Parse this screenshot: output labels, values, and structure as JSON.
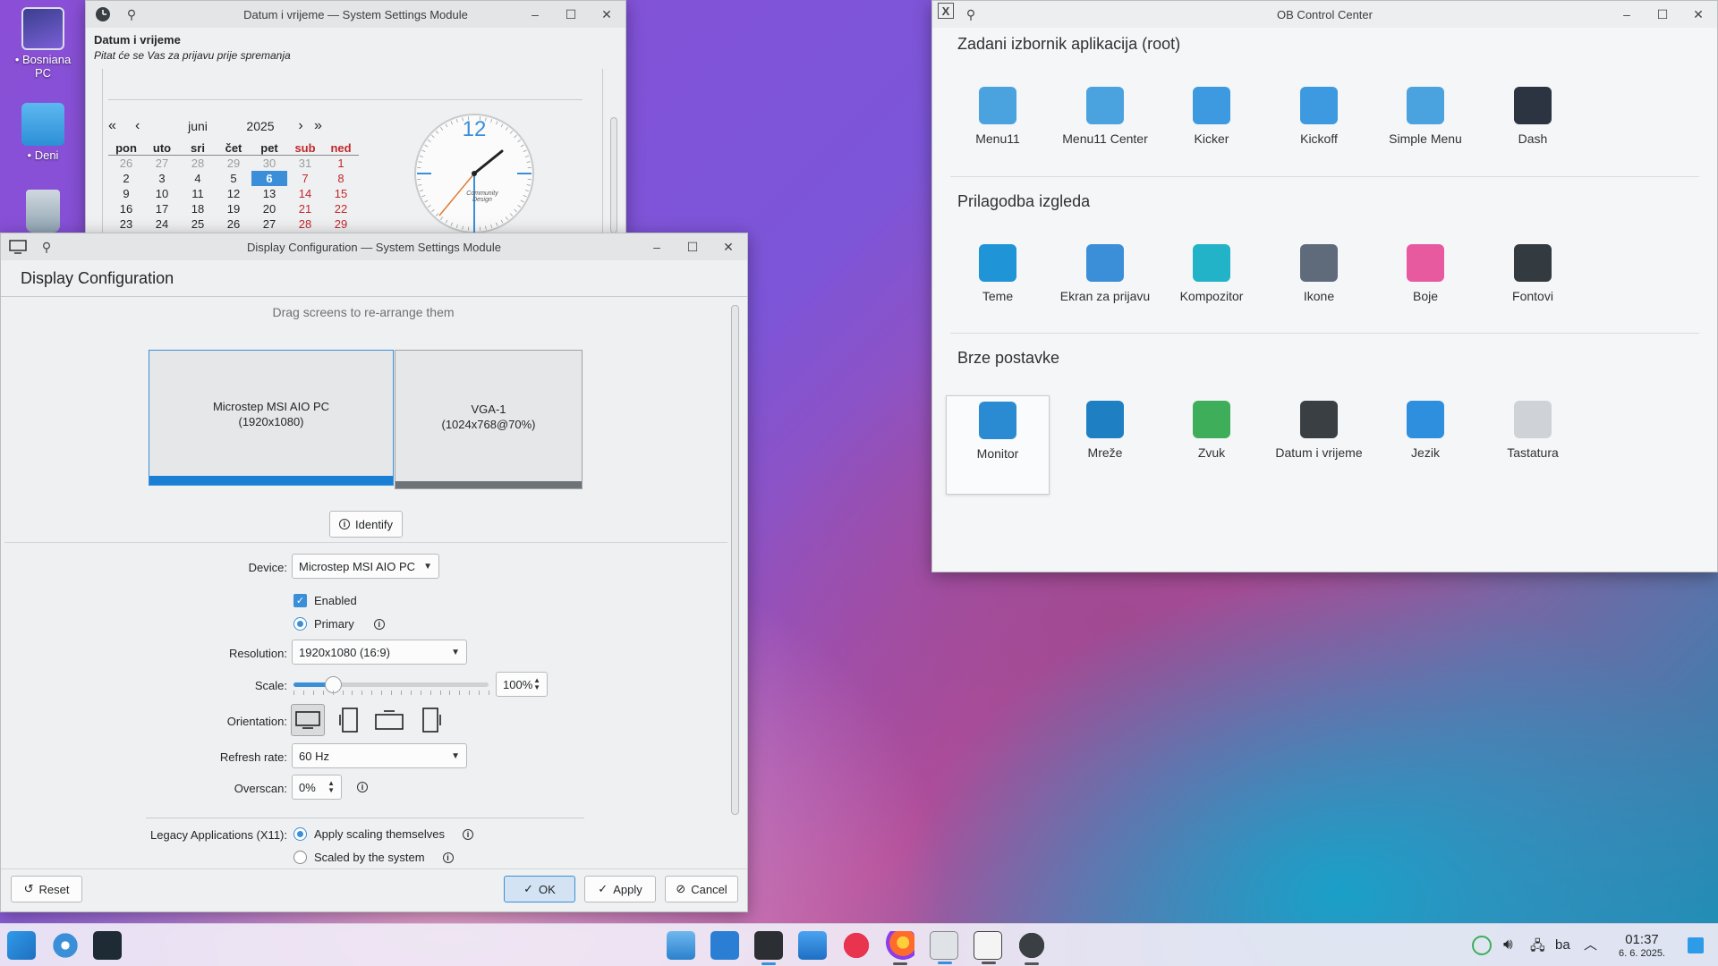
{
  "desktop": {
    "icons": [
      {
        "label": "• Bosniana PC"
      },
      {
        "label": "• Deni"
      },
      {
        "label": ""
      }
    ]
  },
  "datum_window": {
    "title": "Datum i vrijeme — System Settings Module",
    "heading": "Datum i vrijeme",
    "subheading": "Pitat će se Vas za prijavu prije spremanja",
    "month": "juni",
    "year": "2025",
    "weekdays": [
      "pon",
      "uto",
      "sri",
      "čet",
      "pet",
      "sub",
      "ned"
    ],
    "weeks": [
      [
        "26",
        "27",
        "28",
        "29",
        "30",
        "31",
        "1"
      ],
      [
        "2",
        "3",
        "4",
        "5",
        "6",
        "7",
        "8"
      ],
      [
        "9",
        "10",
        "11",
        "12",
        "13",
        "14",
        "15"
      ],
      [
        "16",
        "17",
        "18",
        "19",
        "20",
        "21",
        "22"
      ],
      [
        "23",
        "24",
        "25",
        "26",
        "27",
        "28",
        "29"
      ]
    ],
    "clock_number": "12",
    "clock_brand": "Community Design"
  },
  "display_window": {
    "title": "Display Configuration — System Settings Module",
    "heading": "Display Configuration",
    "hint": "Drag screens to re-arrange them",
    "screens": [
      {
        "name": "Microstep MSI AIO PC",
        "mode": "(1920x1080)"
      },
      {
        "name": "VGA-1",
        "mode": "(1024x768@70%)"
      }
    ],
    "identify_label": "Identify",
    "device_label": "Device:",
    "device_value": "Microstep MSI AIO PC",
    "enabled_label": "Enabled",
    "primary_label": "Primary",
    "resolution_label": "Resolution:",
    "resolution_value": "1920x1080 (16:9)",
    "scale_label": "Scale:",
    "scale_value": "100%",
    "scale_fraction": 0.2,
    "orientation_label": "Orientation:",
    "refresh_label": "Refresh rate:",
    "refresh_value": "60 Hz",
    "overscan_label": "Overscan:",
    "overscan_value": "0%",
    "legacy_label": "Legacy Applications (X11):",
    "legacy_opt1": "Apply scaling themselves",
    "legacy_opt2": "Scaled by the system",
    "reset_label": "Reset",
    "ok_label": "OK",
    "apply_label": "Apply",
    "cancel_label": "Cancel"
  },
  "ob_window": {
    "title": "OB Control Center",
    "sections": [
      {
        "title": "Zadani izbornik aplikacija (root)",
        "items": [
          {
            "label": "Menu11",
            "color": "#4aa3df"
          },
          {
            "label": "Menu11 Center",
            "color": "#4aa3df"
          },
          {
            "label": "Kicker",
            "color": "#3d9ae0"
          },
          {
            "label": "Kickoff",
            "color": "#3d9ae0"
          },
          {
            "label": "Simple Menu",
            "color": "#4aa3df"
          },
          {
            "label": "Dash",
            "color": "#2b3440"
          }
        ]
      },
      {
        "title": "Prilagodba izgleda",
        "items": [
          {
            "label": "Teme",
            "color": "#1f94d6"
          },
          {
            "label": "Ekran za prijavu",
            "color": "#3a8fd8"
          },
          {
            "label": "Kompozitor",
            "color": "#22b3c9"
          },
          {
            "label": "Ikone",
            "color": "#5f6b7a"
          },
          {
            "label": "Boje",
            "color": "#e85aa0"
          },
          {
            "label": "Fontovi",
            "color": "#333a40"
          }
        ]
      },
      {
        "title": "Brze postavke",
        "items": [
          {
            "label": "Monitor",
            "color": "#2a8bd3"
          },
          {
            "label": "Mreže",
            "color": "#1e7fc2"
          },
          {
            "label": "Zvuk",
            "color": "#3fae5a"
          },
          {
            "label": "Datum i vrijeme",
            "color": "#3a3f44"
          },
          {
            "label": "Jezik",
            "color": "#2f8fdf"
          },
          {
            "label": "Tastatura",
            "color": "#cfd3d7"
          }
        ]
      }
    ]
  },
  "taskbar": {
    "language": "ba",
    "time": "01:37",
    "date": "6. 6. 2025."
  }
}
